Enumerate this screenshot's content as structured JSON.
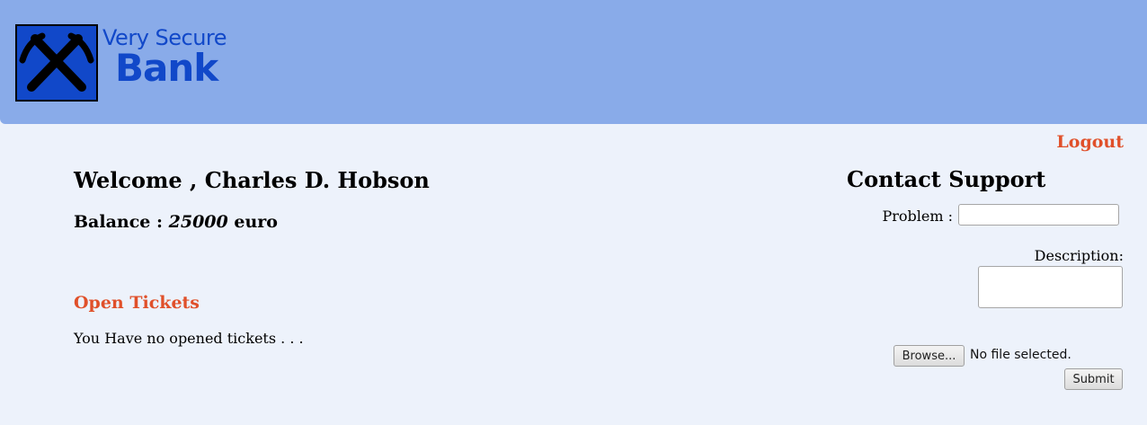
{
  "brand": {
    "line1": "Very Secure",
    "line2": "Bank",
    "colors": {
      "header_bg": "#89abe9",
      "logo_blue": "#1148c9",
      "accent_orange": "#e0502a",
      "page_bg": "#edf2fb"
    }
  },
  "nav": {
    "logout_label": "Logout"
  },
  "account": {
    "welcome_prefix": "Welcome , ",
    "user_name": "Charles D. Hobson",
    "balance_label": "Balance : ",
    "balance_value": "25000",
    "balance_unit": " euro"
  },
  "tickets": {
    "heading": "Open Tickets",
    "empty_message": "You Have no opened tickets . . ."
  },
  "support": {
    "heading": "Contact Support",
    "problem_label": "Problem :",
    "problem_value": "",
    "description_label": "Description:",
    "description_value": "",
    "browse_label": "Browse...",
    "file_status": "No file selected.",
    "submit_label": "Submit"
  },
  "icons": {
    "logo": "crossed-pickaxes-icon"
  }
}
